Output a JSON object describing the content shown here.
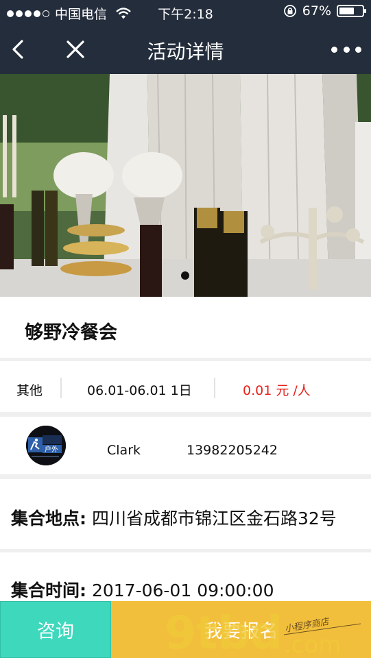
{
  "status_bar": {
    "carrier": "中国电信",
    "time": "下午2:18",
    "battery_percent": "67%",
    "battery_level": 0.67
  },
  "nav": {
    "title": "活动详情",
    "back_icon": "chevron-left-icon",
    "close_icon": "close-icon",
    "more_icon": "more-dots-icon"
  },
  "banner": {
    "slides": 1,
    "active_index": 0
  },
  "activity": {
    "title": "够野冷餐会",
    "category": "其他",
    "dates": "06.01-06.01 1日",
    "price": "0.01 元 /人"
  },
  "organizer": {
    "name": "Clark",
    "phone": "13982205242",
    "avatar_text": "户外"
  },
  "details": {
    "address_label": "集合地点:",
    "address": "四川省成都市锦江区金石路32号",
    "time_label": "集合时间:",
    "time": "2017-06-01 09:00:00"
  },
  "actions": {
    "consult": "咨询",
    "signup": "我要报名"
  },
  "watermark": {
    "main": "9tbd",
    "suffix": ".com",
    "sub": "小程序商店"
  },
  "colors": {
    "nav_bg": "#242d3b",
    "price": "#e8221c",
    "consult_btn": "#3ed8bd",
    "signup_btn": "#f2bf3c"
  }
}
